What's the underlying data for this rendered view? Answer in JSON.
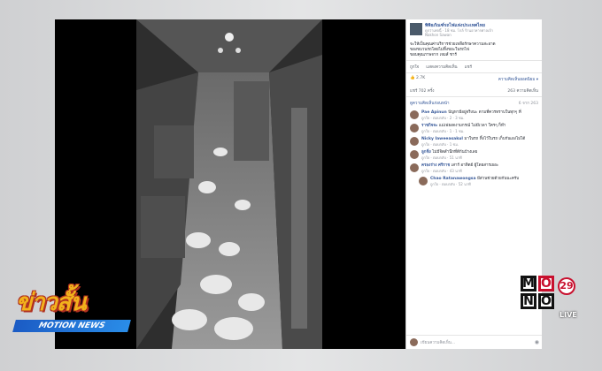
{
  "post": {
    "page_name": "พิพิธภัณฑ์รถไฟแห่งประเทศไทย",
    "meta_line": "ดูกว่าเพจนี้ · 18 ชม. โกล์ ร้านอาหารศาลเจ้า",
    "location": "Nakhon Sawan",
    "text_lines": [
      "จะให้เป็นคุณค่าบริการช่วยเหลือรักษาความสะอาด",
      "ของขบวนรถโดยไม่ทิ้งขยะในรถไฟ",
      "ขอบคุณภาพจาก เจมส์ ชาร์"
    ],
    "actions": [
      "ถูกใจ",
      "แสดงความคิดเห็น",
      "แชร์"
    ],
    "like_count": "2.7K",
    "top_comments": "ความคิดเห็นยอดนิยม ▾",
    "shares": "แชร์ 702 ครั้ง",
    "comments_count": "263 ความคิดเห็น",
    "prev_comments": "ดูความคิดเห็นก่อนหน้า",
    "prev_count": "6 จาก 263"
  },
  "comments": [
    {
      "name": "Pae Apinun",
      "text": "ปัญหามีอยู่จริงนะ ตามที่ควรทราบในทุกๆ ที่",
      "foot": "ถูกใจ · ตอบกลับ · 2 · 3 ชม."
    },
    {
      "name": "ราชกิจจะ",
      "text": "แม่เฟยงดงามกรณ์ ไม่มีเวลา ใครๆ ก็ทำ",
      "foot": "ถูกใจ · ตอบกลับ · 1 · 1 ชม."
    },
    {
      "name": "Nicky Iaweeasakul",
      "text": "มาในรถ ทิ้งไว้ในรถ เก็บกันเองไม่ได้",
      "foot": "ถูกใจ · ตอบกลับ · 1 ชม."
    },
    {
      "name": "ลูกชิ่ง",
      "text": "ไม่มีจิตสำนึกที่ดีกันบ้างเลย",
      "foot": "ถูกใจ · ตอบกลับ · 51 นาที"
    },
    {
      "name": "ครองร่าง ศรีราช",
      "text": "เสาร์ อาทิตย์ ผู้โดยสารเยอะ",
      "foot": "ถูกใจ · ตอบกลับ · 43 นาที"
    },
    {
      "name": "Chao Ratanawongsa",
      "text": "มีส่วนช่วยด้วยกันนะครับ",
      "foot": "ถูกใจ · ตอบกลับ · 52 นาที",
      "reply": true
    }
  ],
  "write_placeholder": "เขียนความคิดเห็น...",
  "logos": {
    "news_thai": "ข่าวสั้น",
    "news_sub": "MOTION NEWS",
    "mono_letters": [
      "M",
      "O",
      "N",
      "O"
    ],
    "mono_channel": "29",
    "live": "LIVE"
  }
}
